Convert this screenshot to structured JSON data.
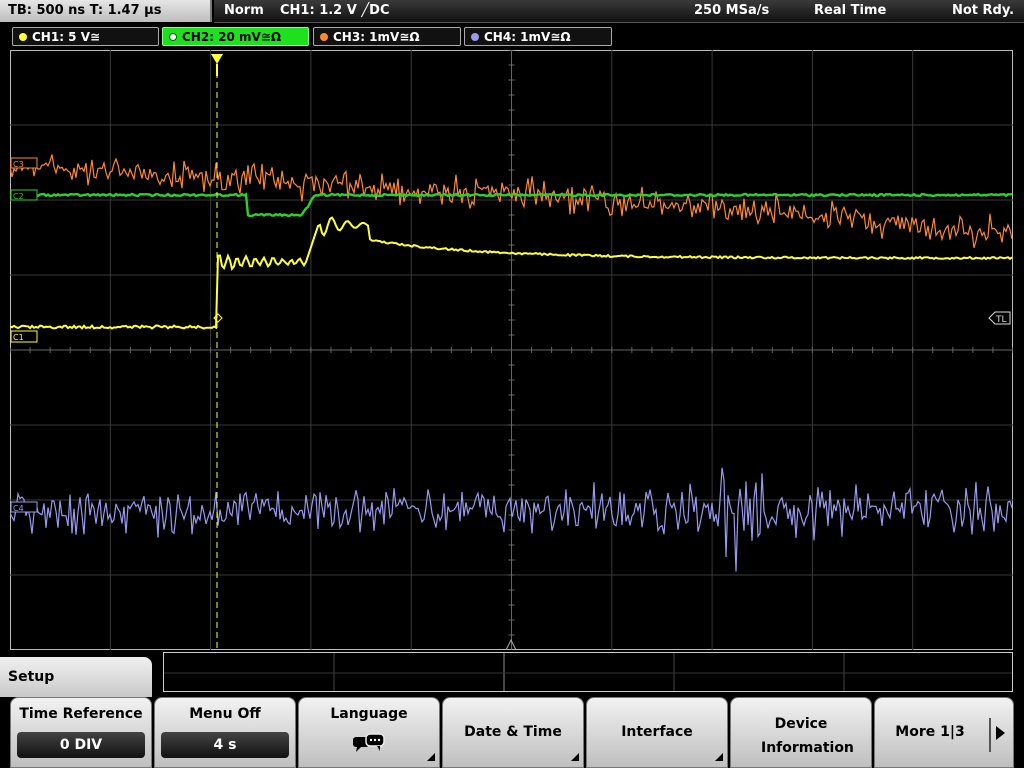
{
  "status": {
    "timebase": "TB: 500 ns   T: 1.47 µs",
    "mode": "Norm",
    "trigger": "CH1: 1.2 V ╱DC",
    "samplerate": "250 MSa/s",
    "acq": "Real Time",
    "ready": "Not Rdy."
  },
  "channels": [
    {
      "label": "CH1: 5 V≅",
      "color": "#ffff33"
    },
    {
      "label": "CH2: 20 mV≅Ω",
      "color": "#2bd22b"
    },
    {
      "label": "CH3: 1mV≅Ω",
      "color": "#ff8a2a"
    },
    {
      "label": "CH4: 1mV≅Ω",
      "color": "#9999ee"
    }
  ],
  "markers": {
    "trigger_level": "TL",
    "ch1": "C1",
    "ch2": "C2",
    "ch3": "C3",
    "ch4": "C4"
  },
  "menu": {
    "title": "Setup",
    "keys": [
      {
        "title": "Time Reference",
        "value": "0 DIV"
      },
      {
        "title": "Menu Off",
        "value": "4 s"
      },
      {
        "title": "Language"
      },
      {
        "title": "Date & Time"
      },
      {
        "title": "Interface"
      },
      {
        "title": "Device Information"
      },
      {
        "title": "More 1|3"
      }
    ]
  },
  "icons": [
    "speech-bubbles-icon",
    "submenu-corner-icon",
    "next-page-arrow-icon",
    "trigger-position-icon"
  ]
}
